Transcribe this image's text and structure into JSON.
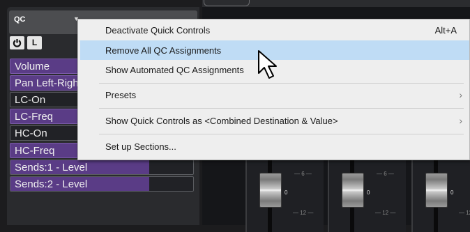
{
  "panel": {
    "title": "QC",
    "menu_arrow": "▼",
    "power_icon": "power-icon",
    "learn_label": "L"
  },
  "qc_slots": [
    {
      "label": "Volume",
      "assigned": true
    },
    {
      "label": "Pan Left-Right",
      "assigned": true
    },
    {
      "label": "LC-On",
      "assigned": false
    },
    {
      "label": "LC-Freq",
      "assigned": true
    },
    {
      "label": "HC-On",
      "assigned": false
    },
    {
      "label": "HC-Freq",
      "assigned": true
    },
    {
      "label": "Sends:1 - Level",
      "assigned": false,
      "level": 0.76
    },
    {
      "label": "Sends:2 - Level",
      "assigned": false,
      "level": 0.76
    }
  ],
  "context_menu": {
    "items": [
      {
        "label": "Deactivate Quick Controls",
        "shortcut": "Alt+A"
      },
      {
        "label": "Remove All QC Assignments",
        "highlighted": true
      },
      {
        "label": "Show Automated QC Assignments"
      },
      {
        "label": "Presets",
        "submenu": "›"
      },
      {
        "label": "Show Quick Controls as <Combined Destination & Value>",
        "submenu": "›"
      },
      {
        "label": "Set up Sections..."
      }
    ]
  },
  "mixer": {
    "zero_label": "0",
    "scale_6": "— 6 —",
    "scale_12": "— 12 —",
    "scale_12_short": "— 12"
  },
  "colors": {
    "assigned_slot": "#5a3c86",
    "menu_highlight": "#bfdcf5",
    "menu_background": "#eeeeee"
  }
}
